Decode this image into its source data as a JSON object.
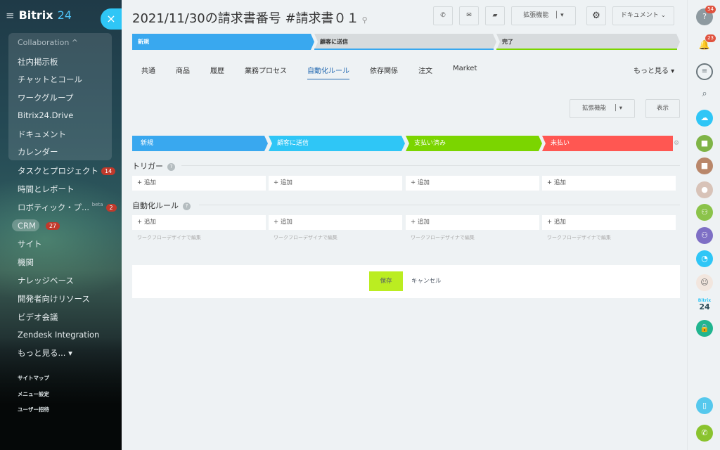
{
  "sidebar": {
    "logo": {
      "part1": "Bitrix",
      "part2": "24"
    },
    "collab_header": "Collaboration ^",
    "items": [
      {
        "label": "社内掲示板"
      },
      {
        "label": "チャットとコール"
      },
      {
        "label": "ワークグループ"
      },
      {
        "label": "Bitrix24.Drive"
      },
      {
        "label": "ドキュメント"
      },
      {
        "label": "カレンダー"
      },
      {
        "label": "タスクとプロジェクト",
        "badge": "14"
      },
      {
        "label": "時間とレポート"
      },
      {
        "label": "ロボティック・プ...",
        "beta": "beta",
        "badge": "2"
      },
      {
        "label": "CRM",
        "badge": "27"
      },
      {
        "label": "サイト"
      },
      {
        "label": "機関"
      },
      {
        "label": "ナレッジベース"
      },
      {
        "label": "開発者向けリソース"
      },
      {
        "label": "ビデオ会議"
      },
      {
        "label": "Zendesk Integration"
      },
      {
        "label": "もっと見る... ▾"
      }
    ],
    "footer": [
      "サイトマップ",
      "メニュー設定",
      "ユーザー招待"
    ]
  },
  "header": {
    "title": "2021/11/30の請求書番号 #請求書０１",
    "ext_label": "拡張機能",
    "doc_label": "ドキュメント"
  },
  "stages_top": [
    "新規",
    "顧客に送信",
    "完了"
  ],
  "tabs": [
    "共通",
    "商品",
    "履歴",
    "業務プロセス",
    "自動化ルール",
    "依存関係",
    "注文",
    "Market"
  ],
  "tabs_more": "もっと見る ▾",
  "ext_button": "拡張機能",
  "view_button": "表示",
  "auto_stages": [
    {
      "label": "新規",
      "color": "#39a8ef"
    },
    {
      "label": "顧客に送信",
      "color": "#2fc6f6"
    },
    {
      "label": "支払い済み",
      "color": "#7bd500"
    },
    {
      "label": "未払い",
      "color": "#ff5752"
    }
  ],
  "trigger_title": "トリガー",
  "automation_title": "自動化ルール",
  "add_label": "+ 追加",
  "wf_label": "ワークフローデザイナで編集",
  "save_label": "保存",
  "cancel_label": "キャンセル",
  "rbar": {
    "badge1": "54",
    "badge2": "23",
    "bitrix_logo_top": "Bitrix",
    "bitrix_logo_bottom": "24"
  }
}
